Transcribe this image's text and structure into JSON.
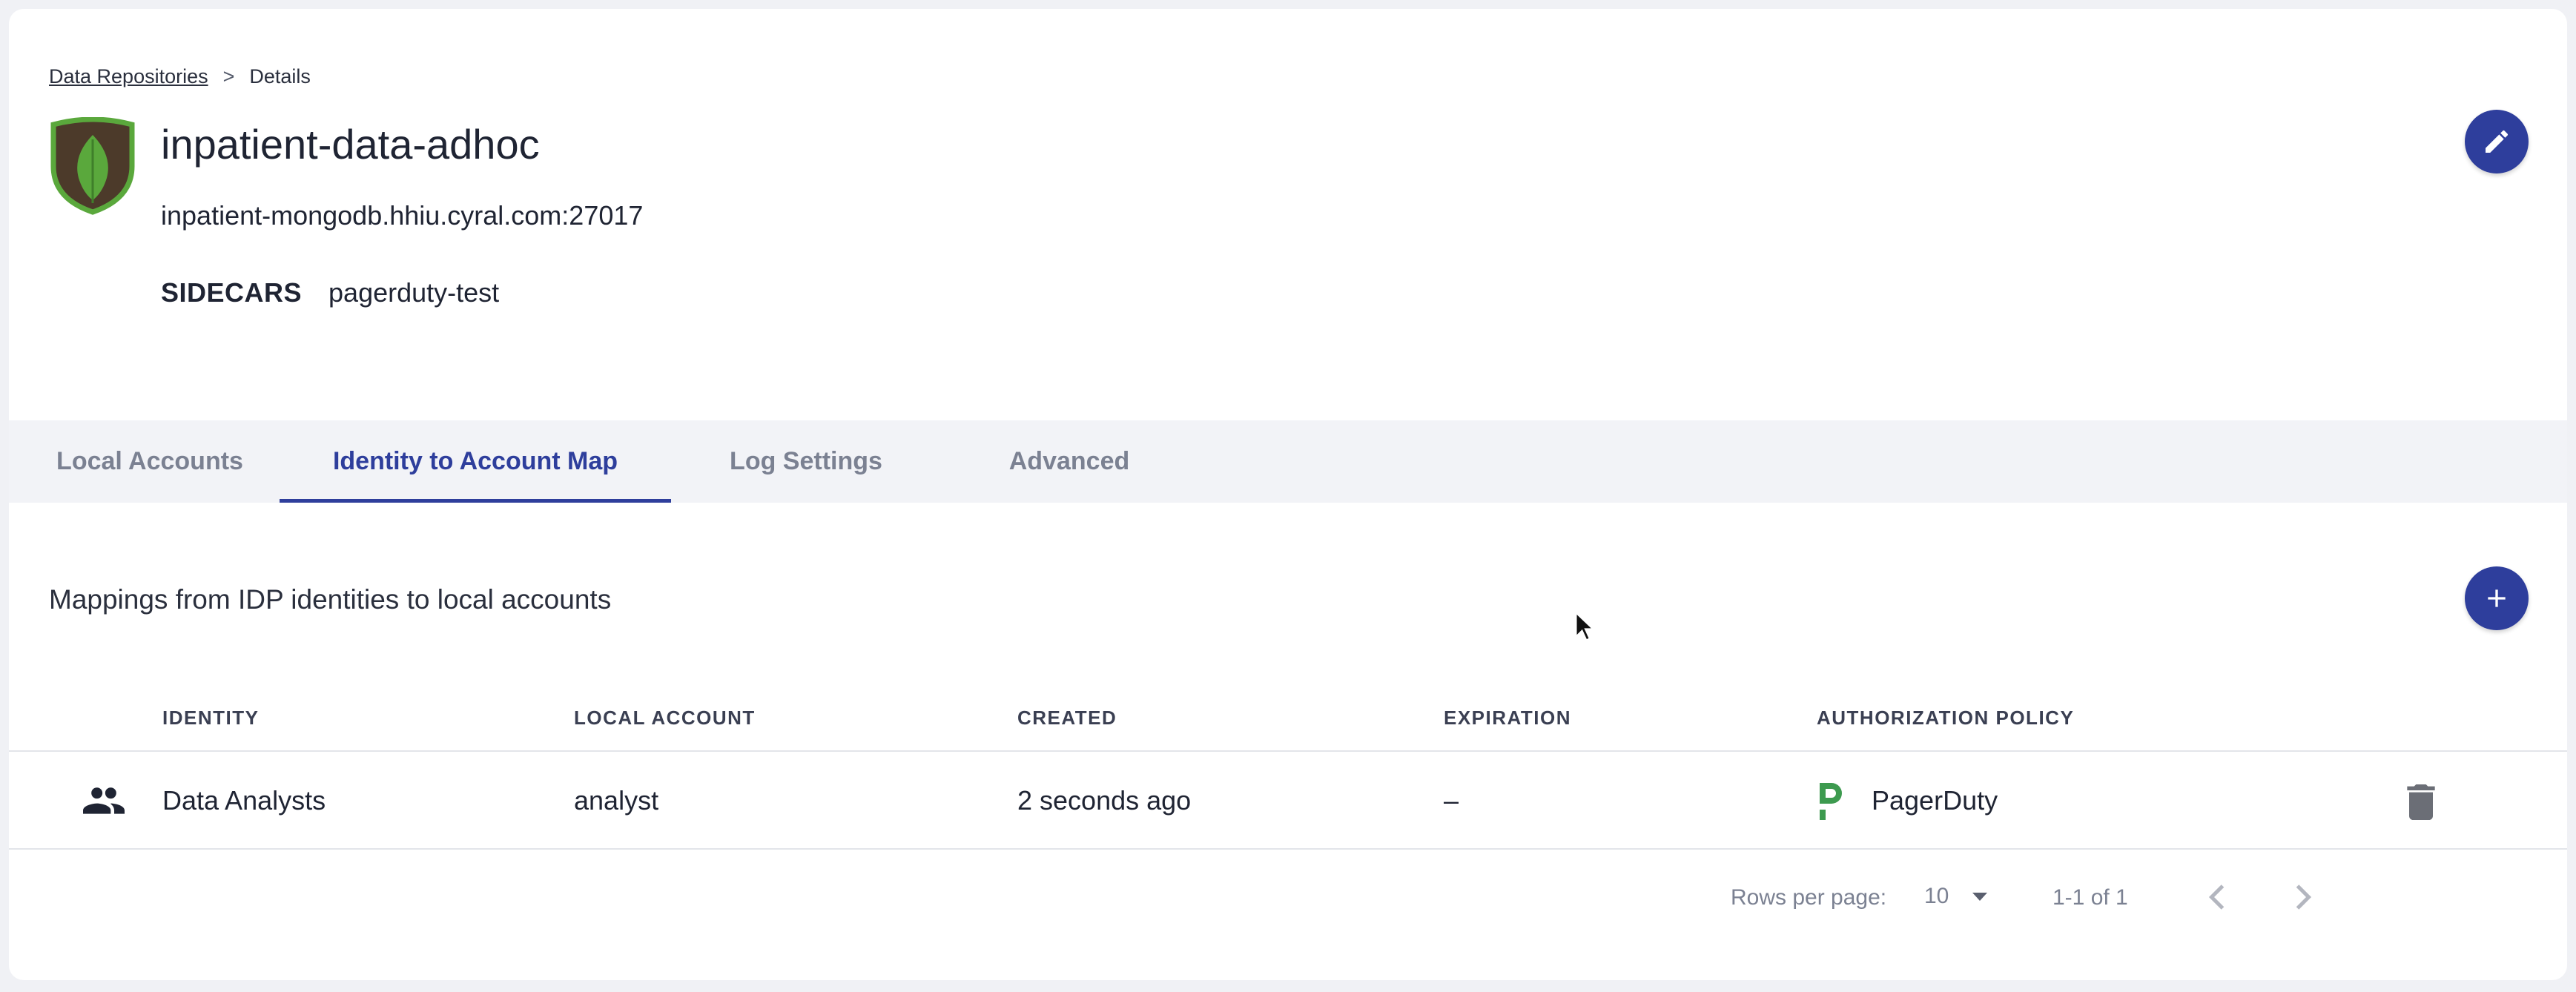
{
  "breadcrumb": {
    "parent": "Data Repositories",
    "separator": ">",
    "current": "Details"
  },
  "repo": {
    "name": "inpatient-data-adhoc",
    "host": "inpatient-mongodb.hhiu.cyral.com:27017",
    "sidecars_label": "SIDECARS",
    "sidecars_value": "pagerduty-test",
    "logo_icon": "mongodb-leaf-icon"
  },
  "actions": {
    "edit_icon": "pencil-icon",
    "add_icon": "plus-icon"
  },
  "tabs": [
    {
      "label": "Local Accounts",
      "active": false
    },
    {
      "label": "Identity to Account Map",
      "active": true
    },
    {
      "label": "Log Settings",
      "active": false
    },
    {
      "label": "Advanced",
      "active": false
    }
  ],
  "section": {
    "title": "Mappings from IDP identities to local accounts"
  },
  "table": {
    "columns": [
      "IDENTITY",
      "LOCAL ACCOUNT",
      "CREATED",
      "EXPIRATION",
      "AUTHORIZATION POLICY"
    ],
    "rows": [
      {
        "identity": "Data Analysts",
        "local_account": "analyst",
        "created": "2 seconds ago",
        "expiration": "–",
        "authorization_policy": "PagerDuty",
        "identity_icon": "people-group-icon",
        "policy_icon": "pagerduty-logo-icon",
        "delete_icon": "trash-icon"
      }
    ]
  },
  "pagination": {
    "rows_per_page_label": "Rows per page:",
    "rows_per_page_value": "10",
    "range_text": "1-1 of 1"
  },
  "colors": {
    "accent": "#2e3e9c",
    "pagerduty_green": "#3d9a4f",
    "mongo_green": "#5aa83c"
  }
}
